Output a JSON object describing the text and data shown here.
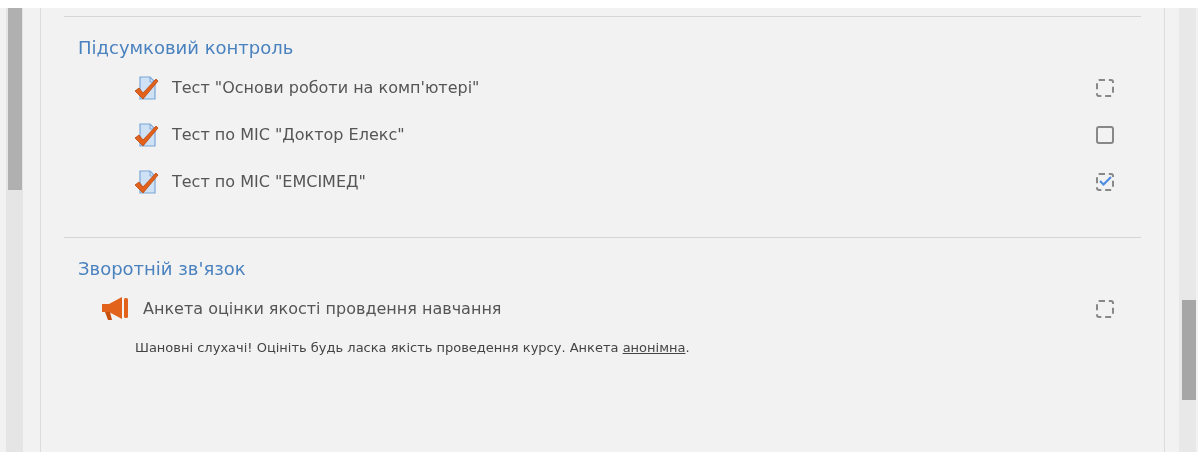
{
  "sections": [
    {
      "title": "Підсумковий контроль",
      "activities": [
        {
          "kind": "quiz",
          "name": "Тест \"Основи роботи на комп'ютері\"",
          "completion": {
            "kind": "auto",
            "checked": false
          }
        },
        {
          "kind": "quiz",
          "name": "Тест по МІС \"Доктор Елекс\"",
          "completion": {
            "kind": "manual",
            "checked": false
          }
        },
        {
          "kind": "quiz",
          "name": "Тест по МІС \"ЕМСІМЕД\"",
          "completion": {
            "kind": "auto",
            "checked": true
          }
        }
      ]
    },
    {
      "title": "Зворотній зв'язок",
      "activities": [
        {
          "kind": "feedback",
          "name": "Анкета оцінки якості провдення навчання",
          "completion": {
            "kind": "auto",
            "checked": false
          },
          "description": {
            "before": "Шановні слухачі! Оцініть будь ласка якість проведення курсу. Анкета",
            "link": "анонімна",
            "after": "."
          }
        }
      ]
    }
  ]
}
